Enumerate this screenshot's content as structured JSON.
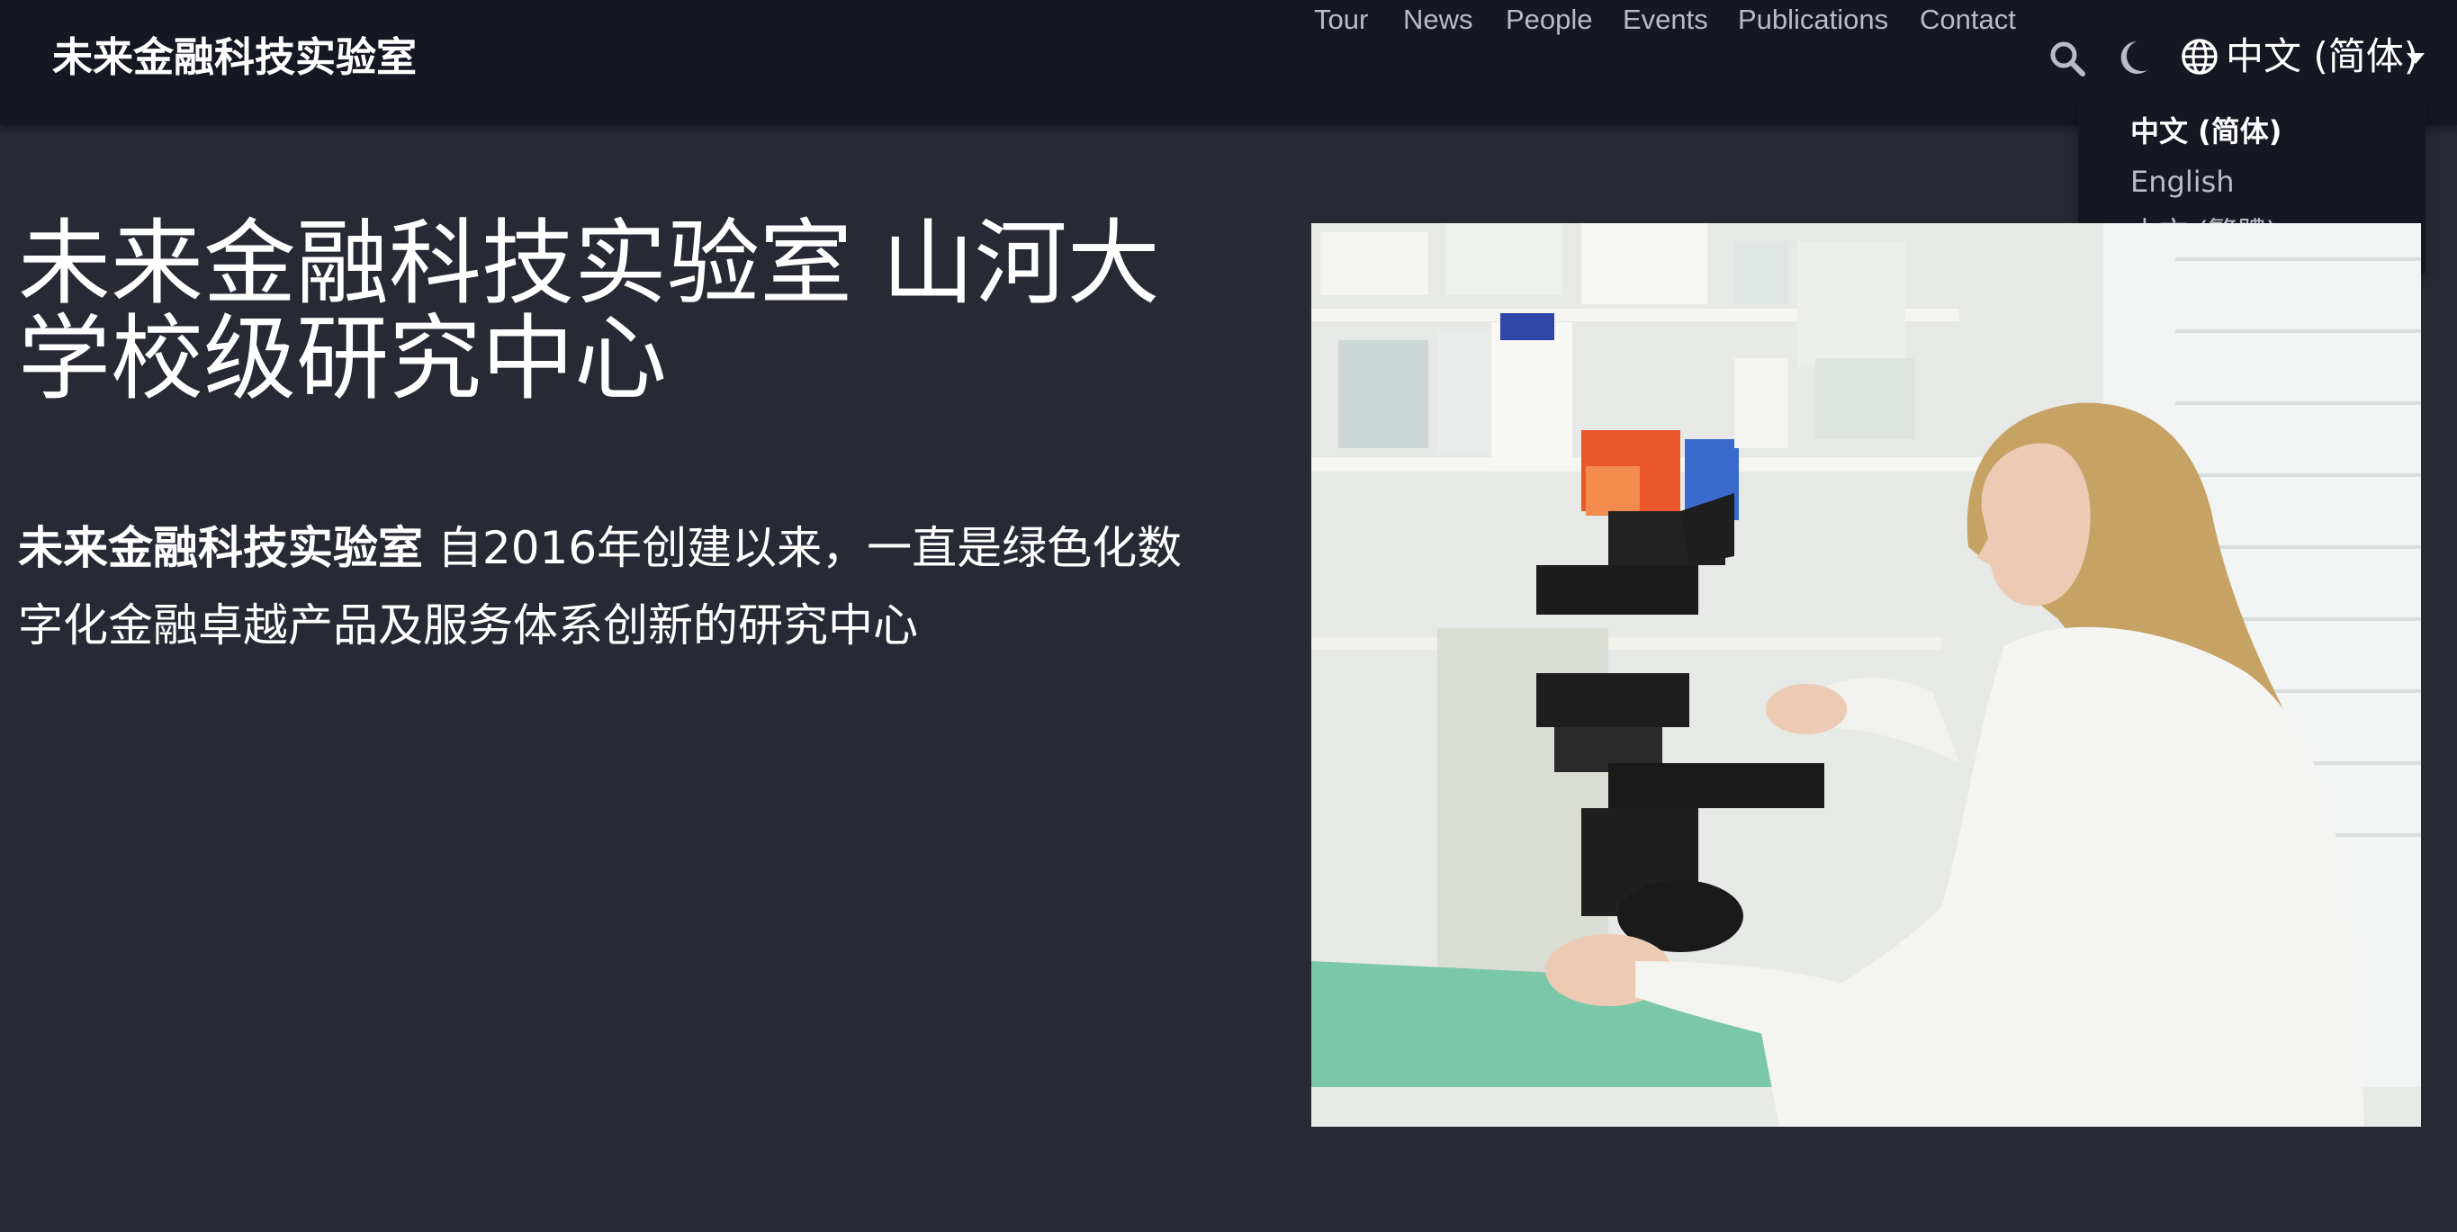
{
  "navbar": {
    "brand": "未来金融科技实验室",
    "links": [
      {
        "label": "Tour",
        "name": "nav-link-tour"
      },
      {
        "label": "News",
        "name": "nav-link-news"
      },
      {
        "label": "People",
        "name": "nav-link-people"
      },
      {
        "label": "Events",
        "name": "nav-link-events"
      },
      {
        "label": "Publications",
        "name": "nav-link-publications"
      },
      {
        "label": "Contact",
        "name": "nav-link-contact"
      }
    ],
    "icons": {
      "search": "search-icon",
      "theme": "moon-icon",
      "language": "globe-icon"
    },
    "language_label": "中文 (简体)"
  },
  "language_menu": {
    "items": [
      {
        "label": "中文 (简体)",
        "active": true
      },
      {
        "label": "English",
        "active": false
      },
      {
        "label": "中文 (繁體)",
        "active": false
      }
    ]
  },
  "hero": {
    "title": "未来金融科技实验室 山河大学校级研究中心",
    "desc_strong": "未来金融科技实验室",
    "desc_rest": " 自2016年创建以来，一直是绿色化数字化金融卓越产品及服务体系创新的研究中心",
    "image_alt": "laboratory-microscope-photo"
  },
  "colors": {
    "navbar_bg": "#151723",
    "page_bg": "#272935",
    "nav_link": "#b9bcc6",
    "text": "#ffffff"
  }
}
